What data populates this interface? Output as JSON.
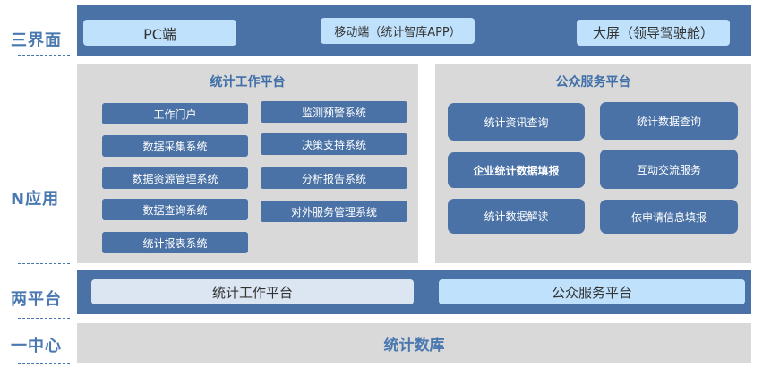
{
  "levels": {
    "interfaces": "三界面",
    "apps": "N应用",
    "platforms": "两平台",
    "center": "一中心"
  },
  "interfaces": {
    "pc": "PC端",
    "mobile": "移动端（统计智库APP）",
    "screen": "大屏（领导驾驶舱）"
  },
  "work_platform": {
    "title": "统计工作平台",
    "systems": [
      "工作门户",
      "监测预警系统",
      "数据采集系统",
      "决策支持系统",
      "数据资源管理系统",
      "分析报告系统",
      "数据查询系统",
      "对外服务管理系统",
      "统计报表系统"
    ]
  },
  "public_platform": {
    "title": "公众服务平台",
    "services": [
      "统计资讯查询",
      "统计数据查询",
      "企业统计数据填报",
      "互动交流服务",
      "统计数据解读",
      "依申请信息填报"
    ]
  },
  "platforms": {
    "work": "统计工作平台",
    "public": "公众服务平台"
  },
  "center": {
    "label": "统计数库"
  },
  "colors": {
    "band": "#4a72a6",
    "level_text": "#4a78b0",
    "light_pill": "#bfe1fb",
    "panel_bg": "#d9d9d9"
  }
}
